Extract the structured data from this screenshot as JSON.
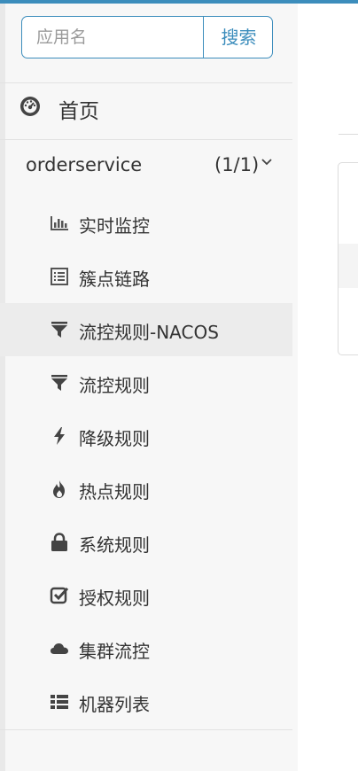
{
  "search": {
    "placeholder": "应用名",
    "button_label": "搜索"
  },
  "nav": {
    "home_label": "首页",
    "app": {
      "name": "orderservice",
      "count": "(1/1)"
    },
    "items": [
      {
        "label": "实时监控",
        "icon": "bar-chart-icon"
      },
      {
        "label": "簇点链路",
        "icon": "list-icon"
      },
      {
        "label": "流控规则-NACOS",
        "icon": "filter-icon",
        "active": true
      },
      {
        "label": "流控规则",
        "icon": "filter-icon"
      },
      {
        "label": "降级规则",
        "icon": "bolt-icon"
      },
      {
        "label": "热点规则",
        "icon": "fire-icon"
      },
      {
        "label": "系统规则",
        "icon": "lock-icon"
      },
      {
        "label": "授权规则",
        "icon": "check-square-icon"
      },
      {
        "label": "集群流控",
        "icon": "cloud-icon"
      },
      {
        "label": "机器列表",
        "icon": "th-list-icon"
      }
    ]
  },
  "colors": {
    "accent": "#3c8dbc",
    "sidebar_bg": "#f7f7f7",
    "active_bg": "#ececec"
  }
}
